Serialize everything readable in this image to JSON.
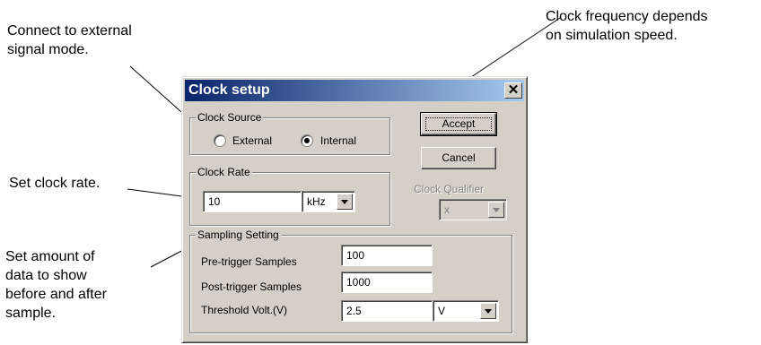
{
  "annotations": {
    "external_mode": "Connect to external\nsignal mode.",
    "clock_frequency": "Clock frequency depends\non simulation speed.",
    "clock_rate": "Set clock rate.",
    "sampling": "Set amount of\ndata to show\nbefore and after\nsample."
  },
  "dialog": {
    "title": "Clock setup",
    "close_glyph": "✕",
    "clock_source": {
      "legend": "Clock Source",
      "external_label": "External",
      "internal_label": "Internal",
      "selected": "Internal"
    },
    "clock_rate": {
      "legend": "Clock Rate",
      "value": "10",
      "unit": "kHz"
    },
    "clock_qualifier": {
      "label": "Clock Qualifier",
      "value": "x"
    },
    "sampling": {
      "legend": "Sampling Setting",
      "pre_label": "Pre-trigger Samples",
      "pre_value": "100",
      "post_label": "Post-trigger Samples",
      "post_value": "1000",
      "threshold_label": "Threshold Volt.(V)",
      "threshold_value": "2.5",
      "threshold_unit": "V"
    },
    "buttons": {
      "accept": "Accept",
      "cancel": "Cancel"
    }
  }
}
